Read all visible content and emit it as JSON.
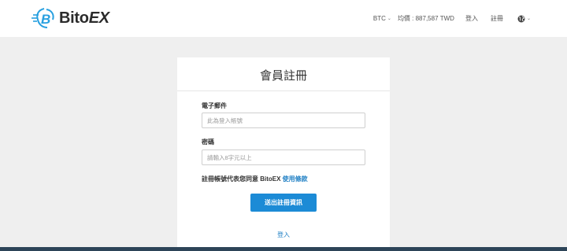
{
  "header": {
    "logo": {
      "text_main": "Bito",
      "text_accent": "EX",
      "mark_letter": "B"
    },
    "nav": {
      "currency": "BTC",
      "price_label": "均價 : 887,587 TWD",
      "login": "登入",
      "register": "註冊",
      "language_icon": "globe-icon"
    }
  },
  "form": {
    "title": "會員註冊",
    "email": {
      "label": "電子郵件",
      "placeholder": "此為登入帳號"
    },
    "password": {
      "label": "密碼",
      "placeholder": "請輸入8字元以上"
    },
    "terms": {
      "prefix": "註冊帳號代表您同意 BitoEX ",
      "link": "使用條款"
    },
    "submit_label": "送出註冊資訊",
    "login_link": "登入"
  },
  "colors": {
    "accent": "#1c8bd6",
    "link": "#1e7fc4",
    "logo_blue": "#28a0e0",
    "footer": "#2d4458",
    "background": "#efefef"
  }
}
